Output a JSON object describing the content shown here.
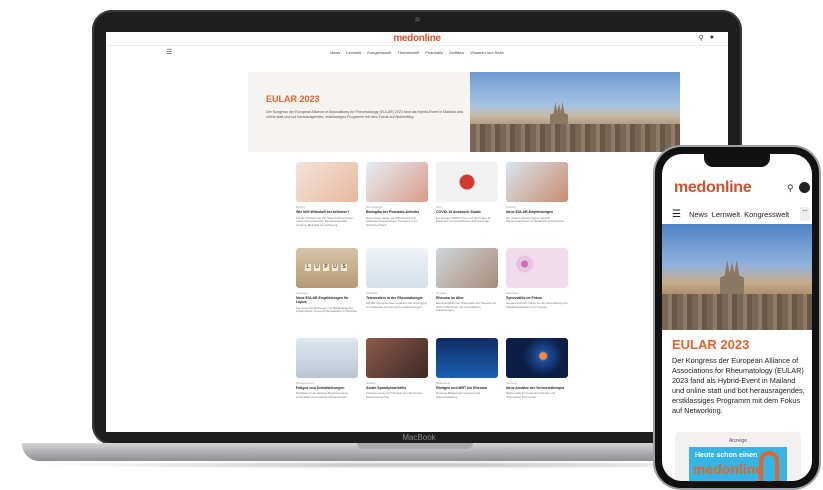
{
  "laptop": {
    "brand": "MacBook",
    "site": {
      "logo_part1": "med",
      "logo_part2": "online",
      "nav": [
        "News",
        "Lernwelt",
        "Kongresswelt",
        "Themenwelt",
        "Pharmalis",
        "Zeitfiken",
        "Volumen und Seite"
      ],
      "hero": {
        "title": "EULAR 2023",
        "description": "Der Kongress der European Alliance of Associations for Rheumatology (EULAR) 2023 fand als Hybrid-Event in Mailand und online statt und bot herausragendes, erstklassiges Programm mit dem Fokus auf Networking."
      },
      "cards": [
        {
          "meta": "Bericht",
          "title": "Wie hilft Wirkstoff bei Arthrose?",
          "text": "Für die Therapie der Psoriasis-Arthritis stehen neben konventionellen Basistherapeutika moderne Biologika zur Verfügung."
        },
        {
          "meta": "Dermatologie",
          "title": "Biologika bei Psoriasis-Arthritis",
          "text": "Neue Daten zeigen die Wirksamkeit und Sicherheit zielgerichteter Therapien in der klinischen Praxis."
        },
        {
          "meta": "Virus",
          "title": "COVID-19 Ausbruch Studie",
          "text": "Der Erreger SARS-CoV-2 und die Folgen für Patienten mit rheumatischen Erkrankungen."
        },
        {
          "meta": "Leitlinie",
          "title": "Neue EULAR-Empfehlungen",
          "text": "Die neuen Leitlinien fassen aktuelle Studienergebnisse zur Behandlung zusammen."
        },
        {
          "meta": "Kongress",
          "title": "Neue EULAR Empfehlungen für Lupus",
          "text": "Die neuen Empfehlungen zur Behandlung des systemischen Lupus erythematodes im Überblick."
        },
        {
          "meta": "Interview",
          "title": "Telemedizin in der Rheumatologie",
          "text": "Digitale Sprechstunden ergänzen die Versorgung von Patienten mit chronischen Erkrankungen."
        },
        {
          "meta": "Geriatrie",
          "title": "Rheuma im Alter",
          "text": "Besonderheiten der Diagnostik und Therapie bei älteren Menschen mit entzündlichen Erkrankungen."
        },
        {
          "meta": "Histologie",
          "title": "Synovialitis im Fokus",
          "text": "Gewebeanalysen helfen bei der Einschätzung der Krankheitsaktivität und Prognose."
        },
        {
          "meta": "Schlafmedizin",
          "title": "Fatigue und Schlafstörungen",
          "text": "Müdigkeit ist ein häufiges Begleitsymptom entzündlich-rheumatischer Erkrankungen."
        },
        {
          "meta": "Rücken",
          "title": "Axiale Spondyloarthritis",
          "text": "Früherkennung und Therapie bei chronischen Rückenschmerzen."
        },
        {
          "meta": "Bildgebung",
          "title": "Röntgen und MRT bei Rheuma",
          "text": "Moderne Bildgebung verbessert die Diagnosestellung."
        },
        {
          "meta": "Schmerz",
          "title": "Neue Ansätze der Schmerztherapie",
          "text": "Multimodale Konzepte für Patienten mit chronischen Schmerzen."
        }
      ]
    }
  },
  "phone": {
    "logo_part1": "med",
    "logo_part2": "online",
    "nav": [
      "News",
      "Lernwelt",
      "Kongresswelt"
    ],
    "more": "...",
    "hero_title": "EULAR 2023",
    "hero_description": "Der Kongress der European Alliance of Associations for Rheumatology (EULAR) 2023 fand als Hybrid-Event in Mailand und online statt und bot herausragendes, erstklassiges Programm mit dem Fokus auf Networking.",
    "ad": {
      "label": "Anzeige",
      "line1": "Heute schon einen",
      "line2": "medonline"
    }
  },
  "colors": {
    "accent": "#e8622a",
    "brand": "#d0522d",
    "ad_blue": "#35b4e6"
  }
}
